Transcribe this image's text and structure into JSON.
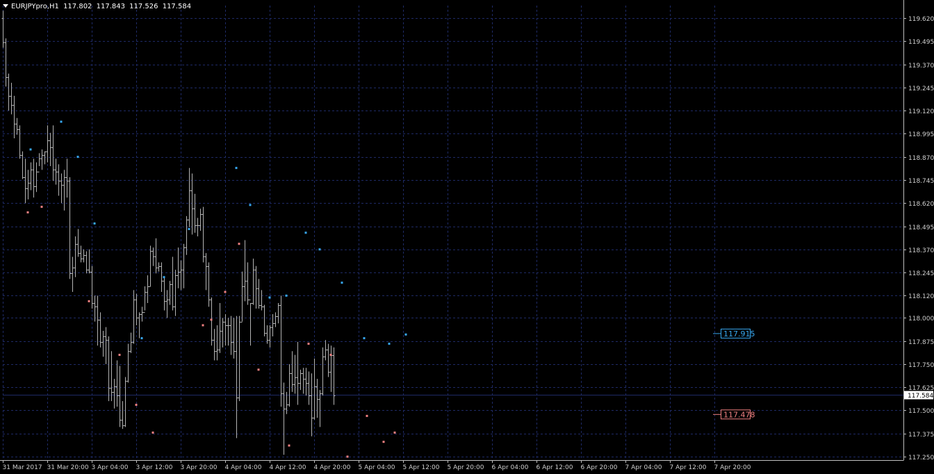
{
  "header": {
    "symbol": "EURJPYpro,H1",
    "open": "117.802",
    "high": "117.843",
    "low": "117.526",
    "close": "117.584"
  },
  "colors": {
    "background": "#000000",
    "grid": "#1e2a66",
    "bars": "#b4b4b4",
    "fractal_up": "#37a8f0",
    "fractal_down": "#f08080",
    "current_price_line": "#1e2a66"
  },
  "current_price": "117.584",
  "label_up": {
    "price": 117.915,
    "text": "117.915"
  },
  "label_down": {
    "price": 117.478,
    "text": "117.478"
  },
  "chart_data": {
    "type": "ohlc",
    "symbol": "EURJPYpro",
    "timeframe": "H1",
    "y_ticks": [
      "119.620",
      "119.495",
      "119.370",
      "119.245",
      "119.120",
      "118.995",
      "118.870",
      "118.745",
      "118.620",
      "118.495",
      "118.370",
      "118.245",
      "118.120",
      "118.000",
      "117.875",
      "117.750",
      "117.625",
      "117.500",
      "117.375",
      "117.250"
    ],
    "ylim": [
      117.24,
      119.69
    ],
    "x_ticks": [
      "31 Mar 2017",
      "31 Mar 20:00",
      "3 Apr 04:00",
      "3 Apr 12:00",
      "3 Apr 20:00",
      "4 Apr 04:00",
      "4 Apr 12:00",
      "4 Apr 20:00",
      "5 Apr 04:00",
      "5 Apr 12:00",
      "5 Apr 20:00",
      "6 Apr 04:00",
      "6 Apr 12:00",
      "6 Apr 20:00",
      "7 Apr 04:00",
      "7 Apr 12:00",
      "7 Apr 20:00"
    ],
    "x_tick_bars": [
      0,
      16,
      32,
      48,
      64,
      80,
      96,
      112,
      128,
      144,
      160,
      176,
      192,
      208,
      224,
      240,
      256
    ],
    "bars": [
      [
        119.62,
        119.66,
        119.46,
        119.49
      ],
      [
        119.49,
        119.51,
        119.25,
        119.3
      ],
      [
        119.3,
        119.32,
        119.12,
        119.2
      ],
      [
        119.2,
        119.27,
        119.1,
        119.15
      ],
      [
        119.15,
        119.2,
        118.97,
        119.05
      ],
      [
        119.05,
        119.08,
        118.99,
        119.02
      ],
      [
        119.02,
        119.04,
        118.86,
        118.88
      ],
      [
        118.88,
        118.9,
        118.75,
        118.76
      ],
      [
        118.76,
        118.86,
        118.62,
        118.7
      ],
      [
        118.7,
        118.8,
        118.64,
        118.73
      ],
      [
        118.73,
        118.84,
        118.69,
        118.8
      ],
      [
        118.8,
        118.86,
        118.65,
        118.71
      ],
      [
        118.71,
        118.84,
        118.68,
        118.79
      ],
      [
        118.79,
        118.89,
        118.82,
        118.86
      ],
      [
        118.86,
        118.91,
        118.8,
        118.88
      ],
      [
        118.88,
        118.9,
        118.83,
        118.9
      ],
      [
        118.9,
        119.04,
        118.84,
        118.96
      ],
      [
        118.96,
        119.0,
        118.82,
        118.92
      ],
      [
        118.92,
        119.04,
        118.74,
        118.8
      ],
      [
        118.8,
        118.86,
        118.72,
        118.79
      ],
      [
        118.79,
        118.83,
        118.66,
        118.74
      ],
      [
        118.74,
        118.78,
        118.62,
        118.72
      ],
      [
        118.72,
        118.8,
        118.58,
        118.76
      ],
      [
        118.76,
        118.86,
        118.65,
        118.74
      ],
      [
        118.74,
        118.76,
        118.21,
        118.24
      ],
      [
        118.24,
        118.33,
        118.14,
        118.27
      ],
      [
        118.27,
        118.44,
        118.22,
        118.4
      ],
      [
        118.4,
        118.48,
        118.33,
        118.35
      ],
      [
        118.35,
        118.39,
        118.3,
        118.32
      ],
      [
        118.32,
        118.37,
        118.3,
        118.34
      ],
      [
        118.34,
        118.36,
        118.24,
        118.26
      ],
      [
        118.26,
        118.37,
        118.24,
        118.25
      ],
      [
        118.25,
        118.28,
        118.05,
        118.08
      ],
      [
        118.08,
        118.12,
        117.98,
        118.06
      ],
      [
        118.06,
        118.12,
        117.85,
        117.99
      ],
      [
        117.99,
        118.03,
        117.84,
        117.87
      ],
      [
        117.87,
        117.93,
        117.79,
        117.9
      ],
      [
        117.9,
        117.95,
        117.75,
        117.88
      ],
      [
        117.88,
        117.9,
        117.55,
        117.62
      ],
      [
        117.62,
        117.82,
        117.55,
        117.6
      ],
      [
        117.6,
        117.67,
        117.51,
        117.63
      ],
      [
        117.63,
        117.77,
        117.52,
        117.58
      ],
      [
        117.58,
        117.74,
        117.41,
        117.45
      ],
      [
        117.45,
        117.55,
        117.4,
        117.42
      ],
      [
        117.42,
        117.68,
        117.41,
        117.66
      ],
      [
        117.66,
        117.86,
        117.65,
        117.82
      ],
      [
        117.82,
        117.92,
        117.81,
        117.87
      ],
      [
        117.87,
        118.15,
        117.86,
        118.1
      ],
      [
        118.1,
        118.13,
        117.96,
        118.0
      ],
      [
        118.0,
        118.03,
        117.89,
        118.02
      ],
      [
        118.02,
        118.06,
        117.98,
        118.03
      ],
      [
        118.03,
        118.17,
        118.04,
        118.14
      ],
      [
        118.14,
        118.23,
        118.08,
        118.17
      ],
      [
        118.17,
        118.39,
        118.17,
        118.36
      ],
      [
        118.36,
        118.38,
        118.28,
        118.33
      ],
      [
        118.33,
        118.43,
        118.24,
        118.27
      ],
      [
        118.27,
        118.3,
        118.25,
        118.28
      ],
      [
        118.28,
        118.3,
        118.14,
        118.2
      ],
      [
        118.2,
        118.22,
        118.04,
        118.09
      ],
      [
        118.09,
        118.15,
        118.0,
        118.1
      ],
      [
        118.1,
        118.2,
        118.07,
        118.18
      ],
      [
        118.18,
        118.33,
        118.04,
        118.06
      ],
      [
        118.06,
        118.26,
        118.01,
        118.23
      ],
      [
        118.23,
        118.38,
        118.16,
        118.25
      ],
      [
        118.25,
        118.31,
        118.15,
        118.26
      ],
      [
        118.26,
        118.4,
        118.16,
        118.38
      ],
      [
        118.38,
        118.55,
        118.34,
        118.53
      ],
      [
        118.53,
        118.81,
        118.49,
        118.69
      ],
      [
        118.69,
        118.78,
        118.45,
        118.59
      ],
      [
        118.59,
        118.67,
        118.46,
        118.5
      ],
      [
        118.5,
        118.54,
        118.44,
        118.5
      ],
      [
        118.5,
        118.59,
        118.47,
        118.56
      ],
      [
        118.56,
        118.6,
        118.3,
        118.33
      ],
      [
        118.33,
        118.35,
        118.15,
        118.28
      ],
      [
        118.28,
        118.3,
        118.06,
        118.1
      ],
      [
        118.1,
        118.11,
        117.85,
        117.88
      ],
      [
        117.88,
        117.94,
        117.77,
        117.82
      ],
      [
        117.82,
        117.96,
        117.77,
        117.83
      ],
      [
        117.83,
        118.08,
        117.81,
        117.93
      ],
      [
        117.93,
        118.0,
        117.84,
        117.98
      ],
      [
        117.98,
        118.02,
        117.85,
        117.96
      ],
      [
        117.96,
        118.0,
        117.85,
        117.96
      ],
      [
        117.96,
        118.01,
        117.8,
        117.87
      ],
      [
        117.87,
        118.0,
        117.78,
        117.82
      ],
      [
        117.82,
        118.01,
        117.35,
        117.57
      ],
      [
        117.57,
        118.01,
        117.55,
        117.98
      ],
      [
        117.98,
        118.25,
        117.98,
        118.17
      ],
      [
        118.17,
        118.42,
        118.09,
        118.2
      ],
      [
        118.2,
        118.3,
        118.07,
        118.1
      ],
      [
        118.1,
        118.08,
        117.85,
        118.08
      ],
      [
        118.08,
        118.32,
        118.07,
        118.26
      ],
      [
        118.26,
        118.28,
        118.05,
        118.16
      ],
      [
        118.16,
        118.21,
        118.05,
        118.07
      ],
      [
        118.07,
        118.15,
        118.04,
        118.06
      ],
      [
        118.06,
        118.07,
        117.9,
        117.92
      ],
      [
        117.92,
        117.96,
        117.86,
        117.88
      ],
      [
        117.88,
        117.96,
        117.84,
        117.95
      ],
      [
        117.95,
        118.02,
        117.9,
        117.97
      ],
      [
        117.97,
        118.03,
        117.95,
        118.01
      ],
      [
        118.01,
        118.08,
        117.97,
        118.07
      ],
      [
        118.07,
        118.12,
        117.52,
        117.59
      ],
      [
        117.59,
        117.65,
        117.26,
        117.51
      ],
      [
        117.51,
        117.6,
        117.48,
        117.53
      ],
      [
        117.53,
        117.75,
        117.52,
        117.7
      ],
      [
        117.7,
        117.82,
        117.6,
        117.64
      ],
      [
        117.64,
        117.8,
        117.59,
        117.68
      ],
      [
        117.68,
        117.87,
        117.53,
        117.65
      ],
      [
        117.65,
        117.72,
        117.61,
        117.7
      ],
      [
        117.7,
        117.73,
        117.59,
        117.67
      ],
      [
        117.67,
        117.73,
        117.58,
        117.65
      ],
      [
        117.65,
        117.71,
        117.53,
        117.58
      ],
      [
        117.58,
        117.7,
        117.36,
        117.46
      ],
      [
        117.46,
        117.78,
        117.45,
        117.63
      ],
      [
        117.63,
        117.67,
        117.46,
        117.56
      ],
      [
        117.56,
        117.61,
        117.41,
        117.59
      ],
      [
        117.59,
        117.84,
        117.58,
        117.79
      ],
      [
        117.79,
        117.88,
        117.77,
        117.83
      ],
      [
        117.83,
        117.86,
        117.68,
        117.71
      ],
      [
        117.71,
        117.85,
        117.6,
        117.8
      ],
      [
        117.8,
        117.84,
        117.53,
        117.58
      ]
    ],
    "fractals_up": [
      [
        10,
        118.91
      ],
      [
        21,
        119.06
      ],
      [
        27,
        118.87
      ],
      [
        33,
        118.51
      ],
      [
        50,
        117.89
      ],
      [
        58,
        118.22
      ],
      [
        67,
        118.48
      ],
      [
        84,
        118.81
      ],
      [
        89,
        118.61
      ],
      [
        96,
        118.11
      ],
      [
        102,
        118.12
      ],
      [
        109,
        118.46
      ],
      [
        114,
        118.37
      ],
      [
        122,
        118.19
      ],
      [
        130,
        117.89
      ],
      [
        139,
        117.86
      ],
      [
        145,
        117.91
      ]
    ],
    "fractals_down": [
      [
        9,
        118.57
      ],
      [
        14,
        118.6
      ],
      [
        31,
        118.09
      ],
      [
        42,
        117.8
      ],
      [
        48,
        117.53
      ],
      [
        54,
        117.38
      ],
      [
        72,
        117.96
      ],
      [
        75,
        117.99
      ],
      [
        80,
        118.14
      ],
      [
        85,
        118.4
      ],
      [
        92,
        117.72
      ],
      [
        103,
        117.31
      ],
      [
        110,
        117.86
      ],
      [
        118,
        117.8
      ],
      [
        124,
        117.25
      ],
      [
        131,
        117.47
      ],
      [
        137,
        117.33
      ],
      [
        141,
        117.38
      ]
    ]
  }
}
